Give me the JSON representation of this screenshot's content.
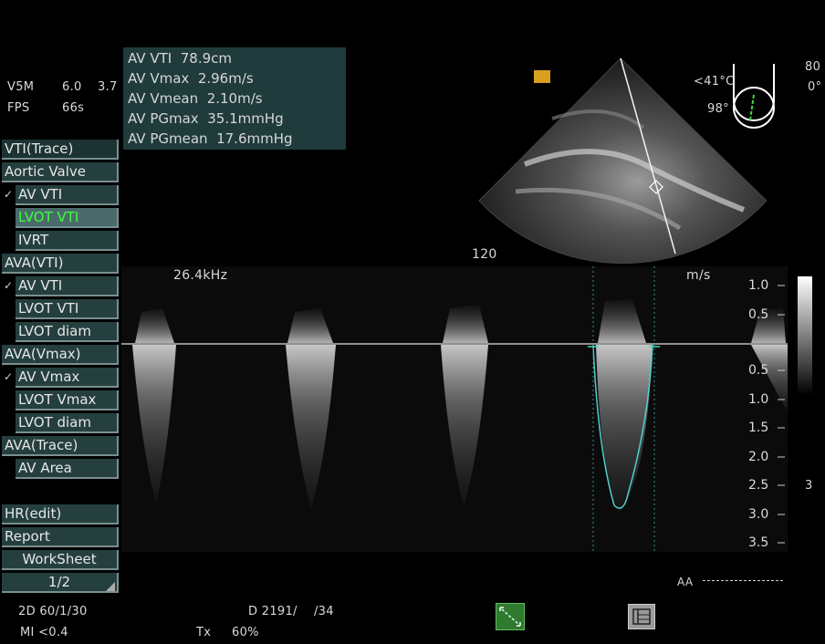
{
  "probe": {
    "name": "V5M",
    "freq_a": "6.0",
    "freq_b": "3.7",
    "fps_label": "FPS",
    "fps_value": "66s"
  },
  "measurements": [
    {
      "label": "AV VTI",
      "value": "78.9cm"
    },
    {
      "label": "AV Vmax",
      "value": "2.96m/s"
    },
    {
      "label": "AV Vmean",
      "value": "2.10m/s"
    },
    {
      "label": "AV PGmax",
      "value": "35.1mmHg"
    },
    {
      "label": "AV PGmean",
      "value": "17.6mmHg"
    }
  ],
  "menu": {
    "title": "VTI(Trace)",
    "items": [
      {
        "label": "Aortic Valve"
      },
      {
        "label": "AV VTI",
        "checked": true
      },
      {
        "label": "LVOT VTI",
        "active": true
      },
      {
        "label": "IVRT"
      },
      {
        "label": "AVA(VTI)"
      },
      {
        "label": "AV VTI",
        "checked": true
      },
      {
        "label": "LVOT VTI"
      },
      {
        "label": "LVOT diam"
      },
      {
        "label": "AVA(Vmax)"
      },
      {
        "label": "AV Vmax",
        "checked": true
      },
      {
        "label": "LVOT Vmax"
      },
      {
        "label": "LVOT diam"
      },
      {
        "label": "AVA(Trace)"
      },
      {
        "label": "AV Area"
      }
    ],
    "bottom": [
      {
        "label": "HR(edit)"
      },
      {
        "label": "Report"
      },
      {
        "label": "WorkSheet"
      },
      {
        "label": "1/2"
      }
    ]
  },
  "image_info": {
    "temp": "<41°C",
    "angle": "98°",
    "depth": "80",
    "rot": "0°",
    "depth_mark": "120"
  },
  "doppler": {
    "prf": "26.4kHz",
    "unit": "m/s",
    "scale_up": [
      "1.0",
      "0.5"
    ],
    "scale_down": [
      "0.5",
      "1.0",
      "1.5",
      "2.0",
      "2.5",
      "3.0",
      "3.5"
    ],
    "gain_marker": "3",
    "sweep_mark": "AA"
  },
  "status": {
    "mode_2d": "2D 60/1/30",
    "mode_d": "D 2191/",
    "mode_d2": "/34",
    "mi": "MI <0.4",
    "tx_label": "Tx",
    "tx_value": "60%"
  },
  "colors": {
    "panel": "#203b3b",
    "menu": "#253f3f",
    "active_text": "#3fff3f",
    "trace": "#4fd0c8"
  }
}
